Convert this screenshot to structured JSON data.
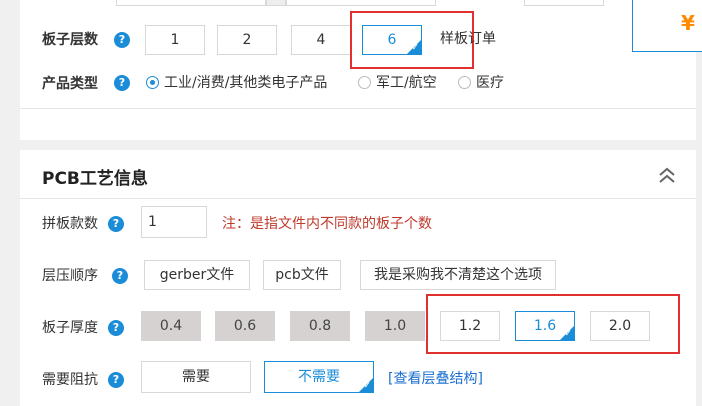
{
  "layers": {
    "label": "板子层数",
    "help": "?",
    "options": [
      "1",
      "2",
      "4",
      "6"
    ],
    "selected": "6",
    "note": "样板订单"
  },
  "product_type": {
    "label": "产品类型",
    "help": "?",
    "options": [
      "工业/消费/其他类电子产品",
      "军工/航空",
      "医疗"
    ],
    "selected": "工业/消费/其他类电子产品"
  },
  "price_symbol": "¥",
  "pcb_section": {
    "title": "PCB工艺信息",
    "panel_count": {
      "label": "拼板款数",
      "help": "?",
      "value": "1",
      "note": "注：是指文件内不同款的板子个数"
    },
    "lamination": {
      "label": "层压顺序",
      "help": "?",
      "options": [
        "gerber文件",
        "pcb文件",
        "我是采购我不清楚这个选项"
      ]
    },
    "thickness": {
      "label": "板子厚度",
      "help": "?",
      "disabled_options": [
        "0.4",
        "0.6",
        "0.8",
        "1.0"
      ],
      "options": [
        "1.2",
        "1.6",
        "2.0"
      ],
      "selected": "1.6"
    },
    "impedance": {
      "label": "需要阻抗",
      "help": "?",
      "options": [
        "需要",
        "不需要"
      ],
      "selected": "不需要",
      "link": "[查看层叠结构]"
    }
  },
  "colors": {
    "accent": "#1a8cd8",
    "highlight_box": "#e03030",
    "note": "#c0392b",
    "price": "#ff8a00"
  }
}
